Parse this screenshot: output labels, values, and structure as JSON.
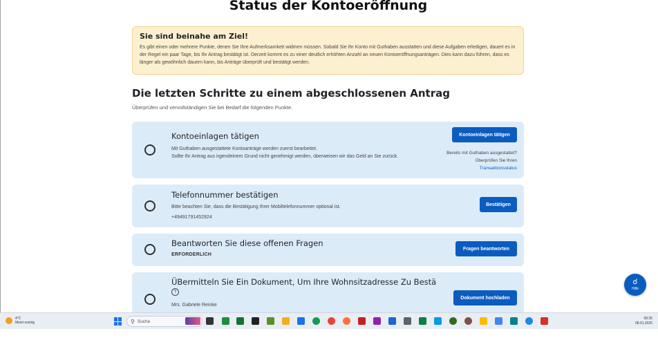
{
  "page": {
    "title": "Status der Kontoeröffnung"
  },
  "banner": {
    "title": "Sie sind beinahe am Ziel!",
    "text": "Es gibt einen oder mehrere Punkte, denen Sie Ihre Aufmerksamkeit widmen müssen. Sobald Sie Ihr Konto mit Guthaben ausstatten und diese Aufgaben erledigen, dauert es in der Regel ein paar Tage, bis Ihr Antrag bestätigt ist. Derzeit kommt es zu einer deutlich erhöhten Anzahl an neuen Kontoeröffnungsanträgen. Dies kann dazu führen, dass es länger als gewöhnlich dauern kann, bis Anträge überprüft und bestätigt werden."
  },
  "section": {
    "title": "Die letzten Schritte zu einem abgeschlossenen Antrag",
    "subtitle": "Überprüfen und vervollständigen Sie bei Bedarf die folgenden Punkte."
  },
  "steps": [
    {
      "title": "Kontoeinlagen tätigen",
      "desc_line1": "Mit Guthaben ausgestattete Kontoanträge werden zuerst bearbeitet.",
      "desc_line2": "Sollte Ihr Antrag aus irgendeinem Grund nicht genehmigt werden, überweisen wir das Geld an Sie zurück.",
      "button": "Kontoeinlagen tätigen",
      "note_line1": "Bereits mit Guthaben ausgestattet?",
      "note_line2": "Überprüfen Sie Ihren",
      "note_link": "Transaktionsstatus"
    },
    {
      "title": "Telefonnummer bestätigen",
      "desc_line1": "Bitte beachten Sie, dass die Bestätigung Ihrer Mobiltelefonnummer optional ist.",
      "phone": "+4949179145​2924",
      "button": "Bestätigen"
    },
    {
      "title": "Beantworten Sie diese offenen Fragen",
      "required": "ERFORDERLICH",
      "button": "Fragen beantworten"
    },
    {
      "title": "ÜBermitteln Sie Ein Dokument, Um Ihre Wohnsitzadresse Zu Bestä",
      "question_mark": "?",
      "person": "Mrs. Gabriele Reinke",
      "button": "Dokument hochladen"
    }
  ],
  "help": {
    "label": "Hilfe"
  },
  "taskbar": {
    "weather_temp": "4°C",
    "weather_desc": "Meist sonnig",
    "search_placeholder": "Suche",
    "time": "09:35",
    "date": "08.01.2025"
  }
}
